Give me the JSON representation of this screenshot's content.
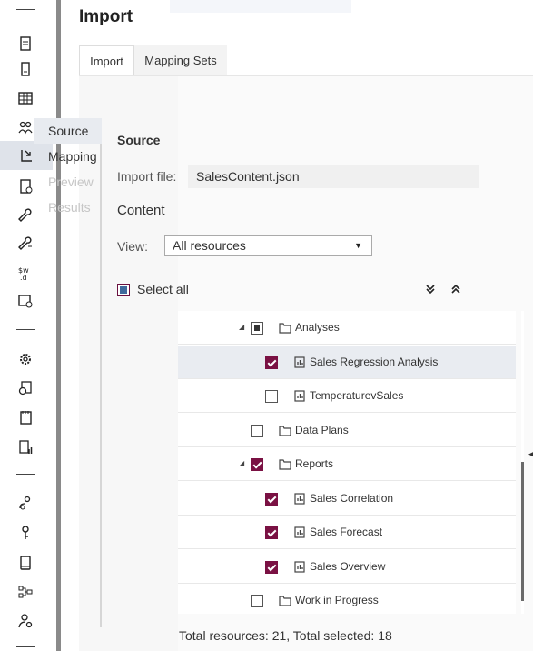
{
  "app": {
    "title": "Import",
    "tabs": [
      {
        "label": "Import",
        "active": true
      },
      {
        "label": "Mapping Sets",
        "active": false
      }
    ]
  },
  "rail_icons": [
    "document-icon",
    "report-icon",
    "table-icon",
    "users-icon",
    "import-icon",
    "checklist-icon",
    "wrench-icon",
    "wrench-list-icon",
    "data-format-icon",
    "window-settings-icon",
    "gear-icon",
    "gear-document-icon",
    "notes-icon",
    "chart-document-icon",
    "user-location-icon",
    "key-icon",
    "tablet-icon",
    "workflow-icon",
    "user-settings-icon"
  ],
  "steps": [
    {
      "label": "Source",
      "state": "active"
    },
    {
      "label": "Mapping",
      "state": "enabled"
    },
    {
      "label": "Preview",
      "state": "disabled"
    },
    {
      "label": "Results",
      "state": "disabled"
    }
  ],
  "source": {
    "section_title": "Source",
    "import_file_label": "Import file:",
    "import_file_value": "SalesContent.json",
    "content_title": "Content",
    "view_label": "View:",
    "view_value": "All resources",
    "select_all_label": "Select all",
    "expand_all_icon": "expand-all-icon",
    "collapse_all_icon": "collapse-all-icon"
  },
  "tree": [
    {
      "name": "Analyses",
      "type": "folder",
      "level": 0,
      "expanded": true,
      "check": "partial",
      "selected": false
    },
    {
      "name": "Sales Regression Analysis",
      "type": "report",
      "level": 1,
      "check": "checked",
      "selected": true
    },
    {
      "name": "TemperaturevSales",
      "type": "report",
      "level": 1,
      "check": "unchecked",
      "selected": false
    },
    {
      "name": "Data Plans",
      "type": "folder",
      "level": 0,
      "check": "unchecked",
      "selected": false
    },
    {
      "name": "Reports",
      "type": "folder",
      "level": 0,
      "expanded": true,
      "check": "checked",
      "selected": false
    },
    {
      "name": "Sales Correlation",
      "type": "report",
      "level": 1,
      "check": "checked",
      "selected": false
    },
    {
      "name": "Sales Forecast",
      "type": "report",
      "level": 1,
      "check": "checked",
      "selected": false
    },
    {
      "name": "Sales Overview",
      "type": "report",
      "level": 1,
      "check": "checked",
      "selected": false
    },
    {
      "name": "Work in Progress",
      "type": "folder",
      "level": 0,
      "check": "unchecked",
      "selected": false
    }
  ],
  "footer": {
    "summary": "Total resources: 21,  Total selected: 18"
  },
  "colors": {
    "checked": "#7a1143",
    "selected_row": "#e9ecf1",
    "rail_active": "#dfe3ea"
  }
}
